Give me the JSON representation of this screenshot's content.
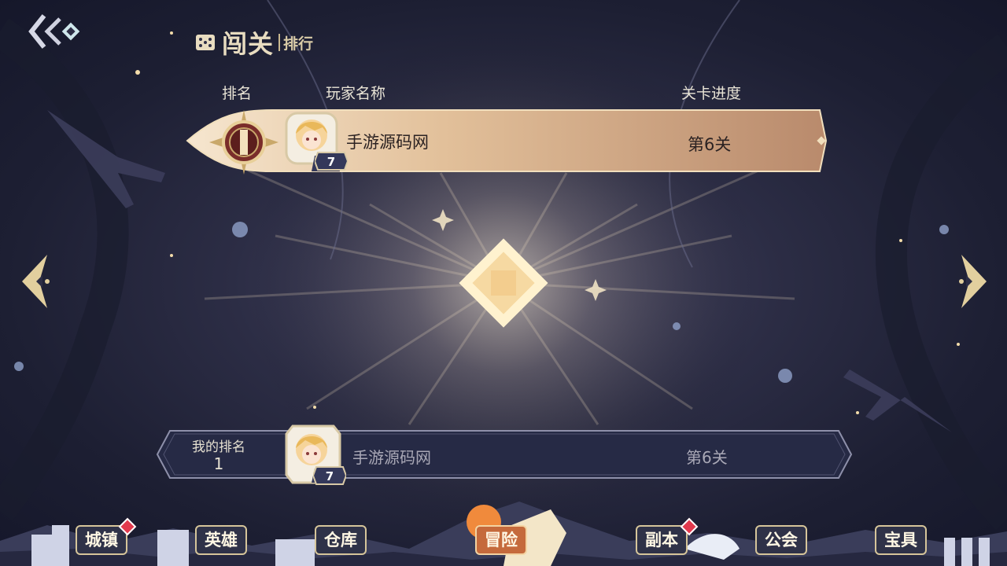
{
  "title": {
    "main": "闯关",
    "sub": "排行"
  },
  "columns": {
    "rank": "排名",
    "player": "玩家名称",
    "progress": "关卡进度"
  },
  "leaderboard": [
    {
      "player": "手游源码网",
      "level": "7",
      "progress": "第6关"
    }
  ],
  "my_rank": {
    "label": "我的排名",
    "rank": "1",
    "player": "手游源码网",
    "level": "7",
    "progress": "第6关"
  },
  "nav": [
    {
      "label": "城镇",
      "badge": true,
      "active": false
    },
    {
      "label": "英雄",
      "badge": false,
      "active": false
    },
    {
      "label": "仓库",
      "badge": false,
      "active": false
    },
    {
      "label": "冒险",
      "badge": false,
      "active": true
    },
    {
      "label": "副本",
      "badge": true,
      "active": false
    },
    {
      "label": "公会",
      "badge": false,
      "active": false
    },
    {
      "label": "宝具",
      "badge": false,
      "active": false
    }
  ],
  "colors": {
    "accent_gold": "#d6c59a",
    "first_row": "#e8c9a6",
    "active_tab": "#c56a3c",
    "badge": "#e2394d"
  },
  "icons": {
    "back": "double-chevron-left-icon",
    "prev": "arrow-left-icon",
    "next": "arrow-right-icon",
    "rank1": "rank-first-emblem-icon"
  }
}
